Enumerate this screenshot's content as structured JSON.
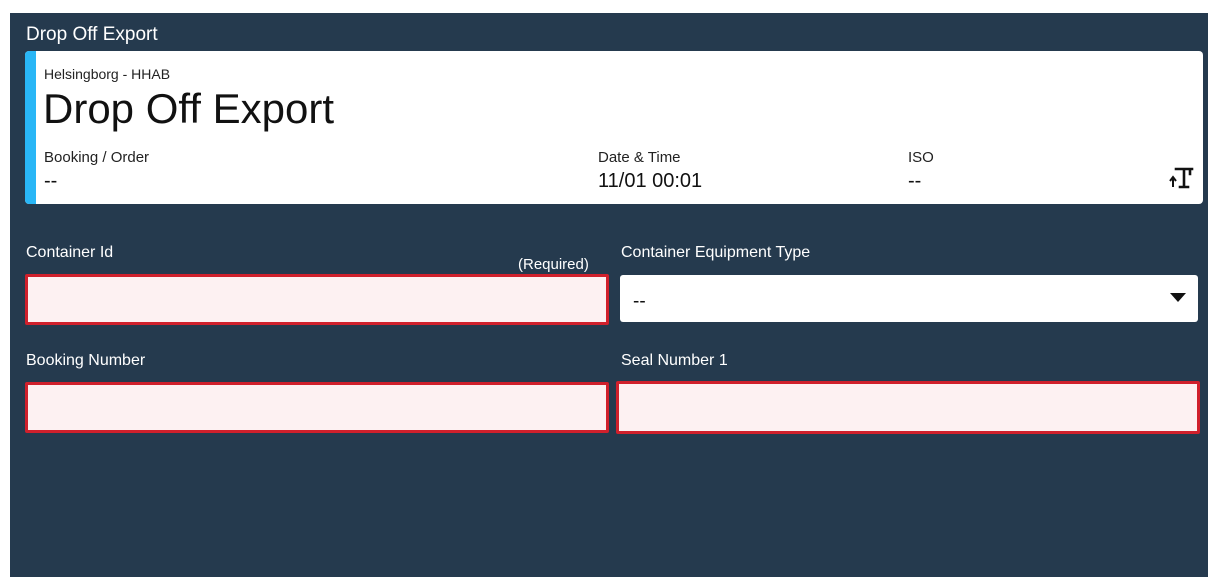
{
  "window": {
    "title": "Drop Off Export"
  },
  "card": {
    "terminal": "Helsingborg - HHAB",
    "title": "Drop Off Export",
    "booking_label": "Booking / Order",
    "booking_value": "--",
    "datetime_label": "Date & Time",
    "datetime_value": "11/01 00:01",
    "iso_label": "ISO",
    "iso_value": "--",
    "icon": "crane-icon",
    "accent_color": "#29b6f6"
  },
  "form": {
    "container_id": {
      "label": "Container Id",
      "required_text": "(Required)",
      "value": ""
    },
    "equipment_type": {
      "label": "Container Equipment Type",
      "selected": "--"
    },
    "booking_number": {
      "label": "Booking Number",
      "value": ""
    },
    "seal_number_1": {
      "label": "Seal Number 1",
      "value": ""
    }
  },
  "colors": {
    "background": "#253a4e",
    "error_border": "#d0202c",
    "error_fill": "#fdf1f2"
  }
}
